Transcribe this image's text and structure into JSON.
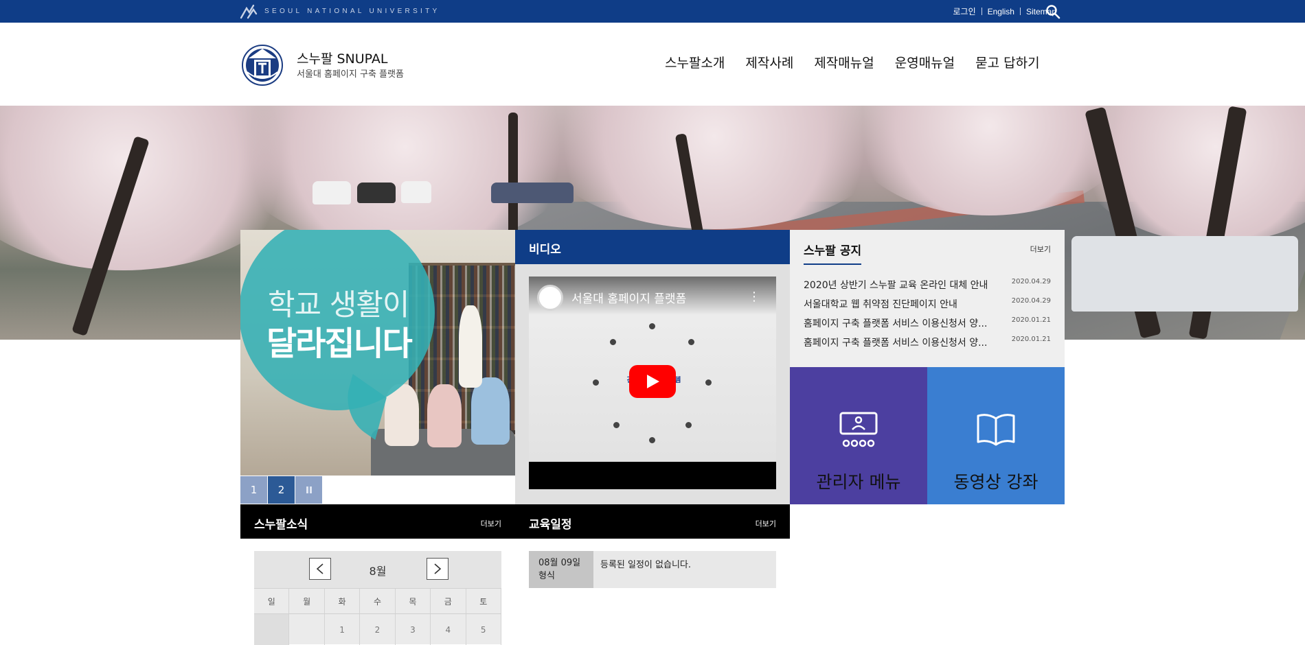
{
  "topbar": {
    "brand": "SEOUL NATIONAL UNIVERSITY",
    "links": [
      "로그인",
      "English",
      "Sitemap"
    ]
  },
  "header": {
    "title": "스누팔 SNUPAL",
    "subtitle": "서울대 홈페이지 구축 플랫폼",
    "nav": [
      "스누팔소개",
      "제작사례",
      "제작매뉴얼",
      "운영매뉴얼",
      "묻고 답하기"
    ]
  },
  "slide": {
    "line1": "학교 생활이",
    "line2": "달라집니다",
    "pager": [
      "1",
      "2"
    ],
    "pause_icon": "pause-icon"
  },
  "video": {
    "heading": "비디오",
    "title": "서울대 홈페이지 플랫폼",
    "intro": "간단, 이지를 구 템"
  },
  "notice": {
    "heading": "스누팔 공지",
    "more": "더보기",
    "items": [
      {
        "title": "2020년 상반기 스누팔 교육 온라인 대체 안내",
        "date": "2020.04.29"
      },
      {
        "title": "서울대학교 웹 취약점 진단페이지 안내",
        "date": "2020.04.29"
      },
      {
        "title": "홈페이지 구축 플랫폼 서비스 이용신청서 양...",
        "date": "2020.01.21"
      },
      {
        "title": "홈페이지 구축 플랫폼 서비스 이용신청서 양...",
        "date": "2020.01.21"
      }
    ]
  },
  "quick": {
    "admin": "관리자 메뉴",
    "lecture": "동영상 강좌"
  },
  "news": {
    "heading": "스누팔소식",
    "more": "더보기",
    "calendar": {
      "month": "8월",
      "weekdays": [
        "일",
        "월",
        "화",
        "수",
        "목",
        "금",
        "토"
      ],
      "days": [
        "",
        "",
        "1",
        "2",
        "3",
        "4",
        "5"
      ]
    }
  },
  "schedule": {
    "heading": "교육일정",
    "more": "더보기",
    "date": "08월 09일",
    "weekday": "형식",
    "empty_text": "등록된 일정이 없습니다."
  },
  "colors": {
    "navy": "#0f3d87",
    "teal": "#34b0b5",
    "purple": "#4c3fa0",
    "blue": "#3a7ed1"
  }
}
